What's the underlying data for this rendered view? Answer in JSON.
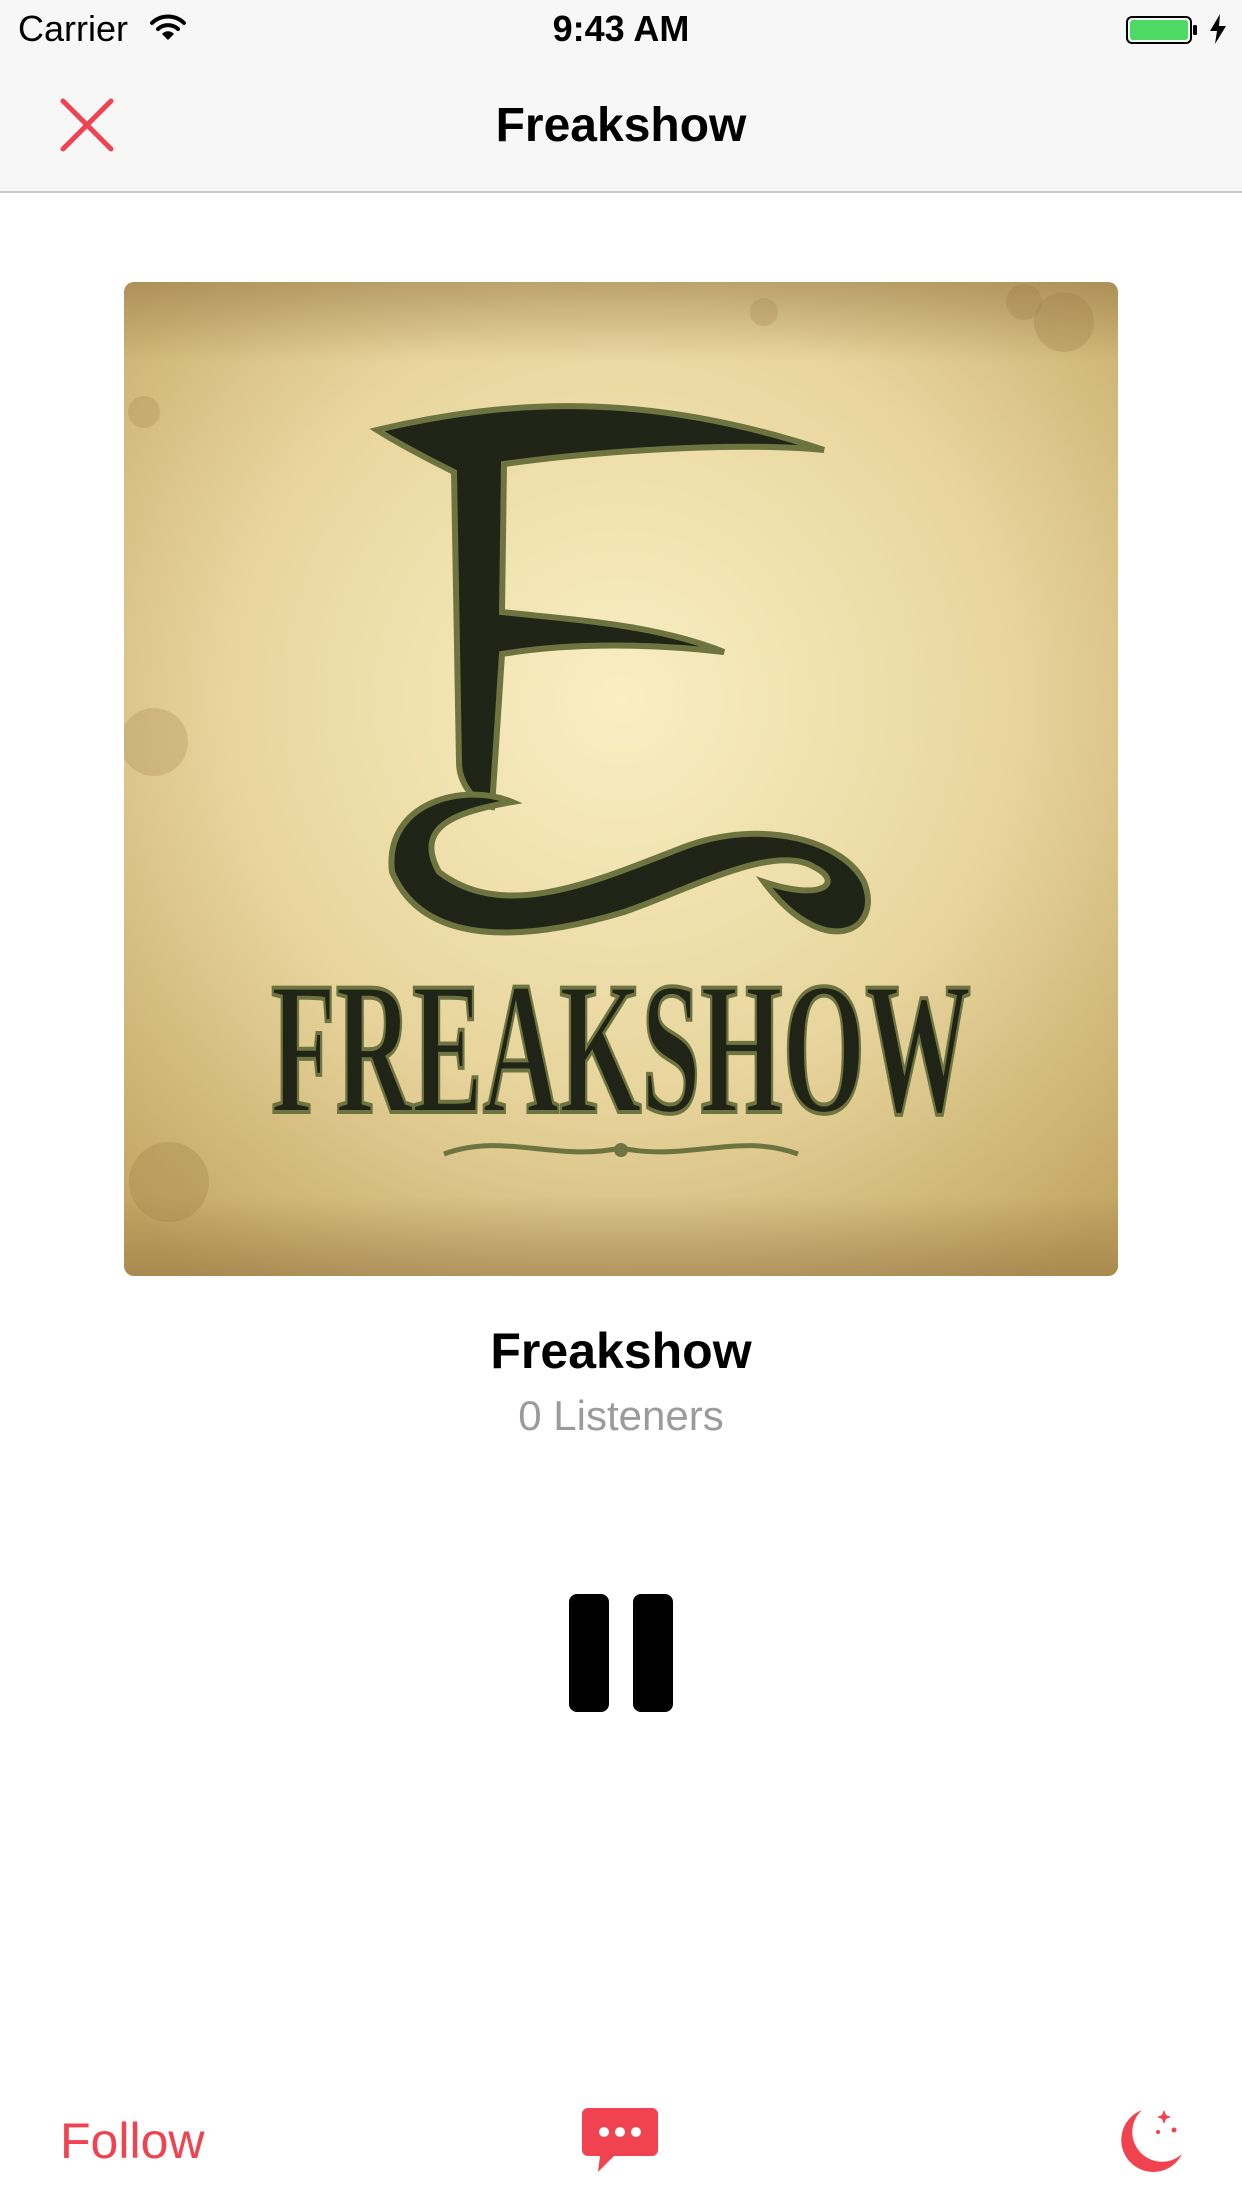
{
  "status_bar": {
    "carrier": "Carrier",
    "time": "9:43 AM",
    "icons": [
      "wifi-icon",
      "battery-icon",
      "charging-icon"
    ]
  },
  "nav": {
    "title": "Freakshow",
    "close_icon": "close-icon"
  },
  "artwork": {
    "wordmark": "FREAKSHOW"
  },
  "station": {
    "name": "Freakshow",
    "listeners": "0 Listeners"
  },
  "controls": {
    "pause_icon": "pause-icon"
  },
  "toolbar": {
    "follow_label": "Follow",
    "chat_icon": "chat-icon",
    "sleep_icon": "moon-icon"
  },
  "colors": {
    "accent": "#f0434f",
    "battery": "#4cd964",
    "subtitle": "#9b9b9b"
  }
}
